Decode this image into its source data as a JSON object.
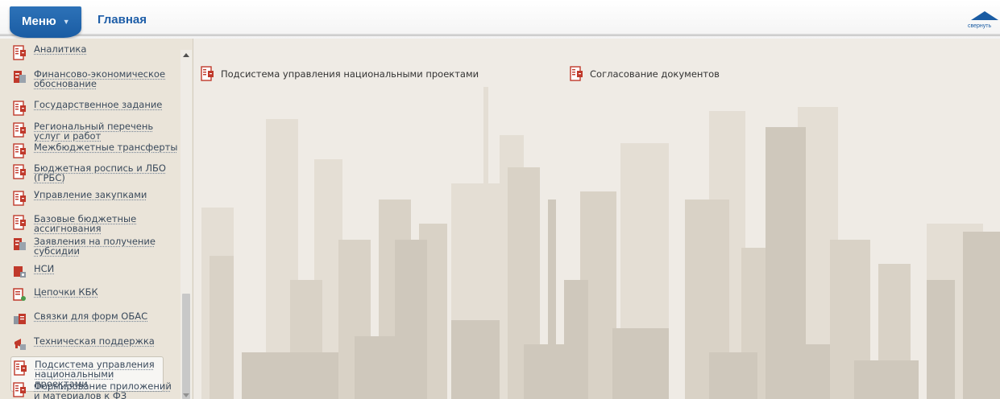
{
  "header": {
    "menu_label": "Меню",
    "title": "Главная",
    "collapse_label": "свернуть"
  },
  "sidebar": {
    "items": [
      {
        "label": "Аналитика",
        "icon": "document-icon"
      },
      {
        "label": "Финансово-экономическое обоснование",
        "icon": "report-icon"
      },
      {
        "label": "Государственное задание",
        "icon": "document-icon"
      },
      {
        "label": "Региональный перечень услуг и работ",
        "icon": "document-icon"
      },
      {
        "label": "Межбюджетные трансферты",
        "icon": "document-icon"
      },
      {
        "label": "Бюджетная роспись и ЛБО (ГРБС)",
        "icon": "document-icon"
      },
      {
        "label": "Управление закупками",
        "icon": "document-icon"
      },
      {
        "label": "Базовые бюджетные ассигнования",
        "icon": "document-icon"
      },
      {
        "label": "Заявления на получение субсидии",
        "icon": "report-icon"
      },
      {
        "label": "НСИ",
        "icon": "reference-icon"
      },
      {
        "label": "Цепочки КБК",
        "icon": "chain-icon"
      },
      {
        "label": "Связки для форм ОБАС",
        "icon": "link-forms-icon"
      },
      {
        "label": "Техническая поддержка",
        "icon": "support-icon"
      },
      {
        "label": "Подсистема управления национальными проектами",
        "icon": "document-icon",
        "active": true
      },
      {
        "label": "Формирование приложений и материалов к ФЗ",
        "icon": "document-icon"
      }
    ]
  },
  "content": {
    "items": [
      {
        "label": "Подсистема управления национальными проектами",
        "icon": "document-icon"
      },
      {
        "label": "Согласование документов",
        "icon": "document-icon"
      }
    ]
  },
  "colors": {
    "accent": "#1a5ca3",
    "doc_icon": "#c0392b",
    "background": "#efebe5"
  }
}
